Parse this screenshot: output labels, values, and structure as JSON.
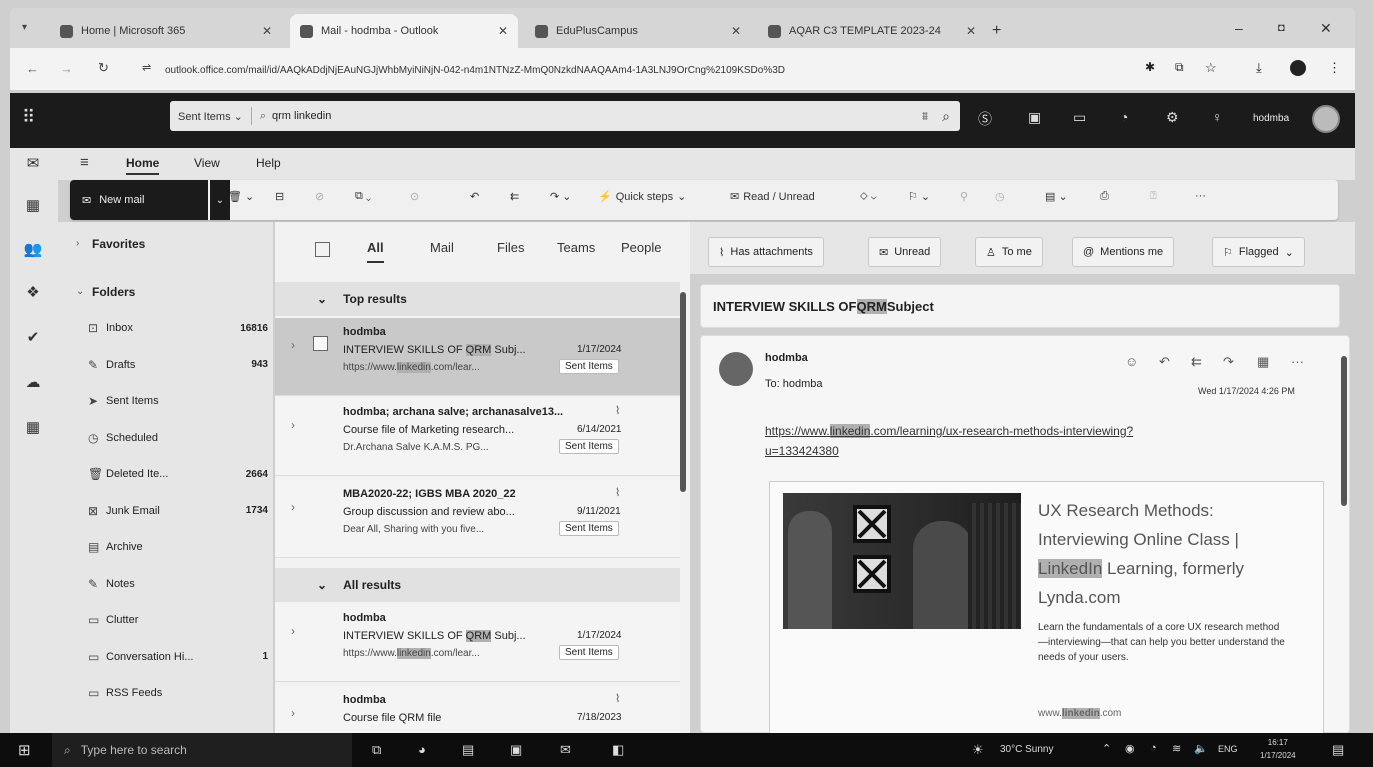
{
  "browser": {
    "tabs": [
      {
        "label": "Home | Microsoft 365",
        "active": false
      },
      {
        "label": "Mail - hodmba - Outlook",
        "active": true
      },
      {
        "label": "EduPlusCampus",
        "active": false
      },
      {
        "label": "AQAR C3 TEMPLATE 2023-24",
        "active": false
      }
    ],
    "url": "outlook.office.com/mail/id/AAQkADdjNjEAuNGJjWhbMyiNiNjN-042-n4m1NTNzZ-MmQ0NzkdNAAQAAm4-1A3LNJ9OrCng%2109KSDo%3D"
  },
  "outlook": {
    "search_scope": "Sent Items",
    "search_query": "qrm linkedin",
    "username": "hodmba",
    "ribbon_tabs": [
      "Home",
      "View",
      "Help"
    ],
    "new_mail_label": "New mail",
    "quick_steps_label": "Quick steps",
    "read_unread_label": "Read / Unread",
    "more_label": "···"
  },
  "folders": {
    "favorites_label": "Favorites",
    "folders_label": "Folders",
    "items": [
      {
        "icon": "inbox-icon",
        "glyph": "⊡",
        "label": "Inbox",
        "count": "16816"
      },
      {
        "icon": "drafts-icon",
        "glyph": "✎",
        "label": "Drafts",
        "count": "943"
      },
      {
        "icon": "sent-icon",
        "glyph": "➤",
        "label": "Sent Items",
        "count": ""
      },
      {
        "icon": "scheduled-icon",
        "glyph": "◷",
        "label": "Scheduled",
        "count": ""
      },
      {
        "icon": "deleted-icon",
        "glyph": "🗑",
        "label": "Deleted Ite...",
        "count": "2664"
      },
      {
        "icon": "junk-icon",
        "glyph": "⊠",
        "label": "Junk Email",
        "count": "1734"
      },
      {
        "icon": "archive-icon",
        "glyph": "▤",
        "label": "Archive",
        "count": ""
      },
      {
        "icon": "notes-icon",
        "glyph": "✎",
        "label": "Notes",
        "count": ""
      },
      {
        "icon": "clutter-icon",
        "glyph": "▭",
        "label": "Clutter",
        "count": ""
      },
      {
        "icon": "conversation-icon",
        "glyph": "▭",
        "label": "Conversation Hi...",
        "count": "1"
      },
      {
        "icon": "rss-icon",
        "glyph": "▭",
        "label": "RSS Feeds",
        "count": ""
      }
    ]
  },
  "filter_tabs": [
    "All",
    "Mail",
    "Files",
    "Teams",
    "People"
  ],
  "filter_chips": [
    "Has attachments",
    "Unread",
    "To me",
    "Mentions me",
    "Flagged"
  ],
  "sections": {
    "top": "Top results",
    "all": "All results"
  },
  "messages": [
    {
      "from": "hodmba",
      "subject_pre": "INTERVIEW SKILLS OF ",
      "subject_hl": "QRM",
      "subject_post": " Subj...",
      "date": "1/17/2024",
      "preview_pre": "https://www.",
      "preview_hl": "linkedin",
      "preview_post": ".com/lear...",
      "folder": "Sent Items",
      "attachment": false,
      "selected": true
    },
    {
      "from": "hodmba; archana salve; archanasalve13...",
      "subject_pre": "Course file of Marketing research...",
      "subject_hl": "",
      "subject_post": "",
      "date": "6/14/2021",
      "preview_pre": "Dr.Archana Salve K.A.M.S. PG...",
      "preview_hl": "",
      "preview_post": "",
      "folder": "Sent Items",
      "attachment": true,
      "selected": false
    },
    {
      "from": "MBA2020-22; IGBS MBA 2020_22",
      "subject_pre": "Group discussion and review abo...",
      "subject_hl": "",
      "subject_post": "",
      "date": "9/11/2021",
      "preview_pre": "Dear All, Sharing with you five...",
      "preview_hl": "",
      "preview_post": "",
      "folder": "Sent Items",
      "attachment": true,
      "selected": false
    },
    {
      "from": "hodmba",
      "subject_pre": "INTERVIEW SKILLS OF ",
      "subject_hl": "QRM",
      "subject_post": " Subj...",
      "date": "1/17/2024",
      "preview_pre": "https://www.",
      "preview_hl": "linkedin",
      "preview_post": ".com/lear...",
      "folder": "Sent Items",
      "attachment": false,
      "selected": false
    },
    {
      "from": "hodmba",
      "subject_pre": "Course file QRM file",
      "subject_hl": "",
      "subject_post": "",
      "date": "7/18/2023",
      "preview_pre": "",
      "preview_hl": "",
      "preview_post": "",
      "folder": "",
      "attachment": true,
      "selected": false
    }
  ],
  "reading": {
    "subject_pre": "INTERVIEW SKILLS OF ",
    "subject_hl": "QRM",
    "subject_post": " Subject",
    "from": "hodmba",
    "to_label": "To:",
    "to": "hodmba",
    "datetime": "Wed 1/17/2024 4:26 PM",
    "link_pre": "https://www.",
    "link_hl": "linkedin",
    "link_post": ".com/learning/ux-research-methods-interviewing?",
    "link_line2": "u=133424380",
    "card_title_1": "UX Research Methods:",
    "card_title_2": "Interviewing Online Class |",
    "card_title_hl": "LinkedIn",
    "card_title_3": " Learning, formerly",
    "card_title_4": "Lynda.com",
    "card_desc": "Learn the fundamentals of a core UX research method—interviewing—that can help you better understand the needs of your users.",
    "card_domain_pre": "www.",
    "card_domain_hl": "linkedin",
    "card_domain_post": ".com"
  },
  "taskbar": {
    "search_placeholder": "Type here to search",
    "weather": "30°C Sunny",
    "lang": "ENG",
    "time": "16:17",
    "date": "1/17/2024"
  }
}
